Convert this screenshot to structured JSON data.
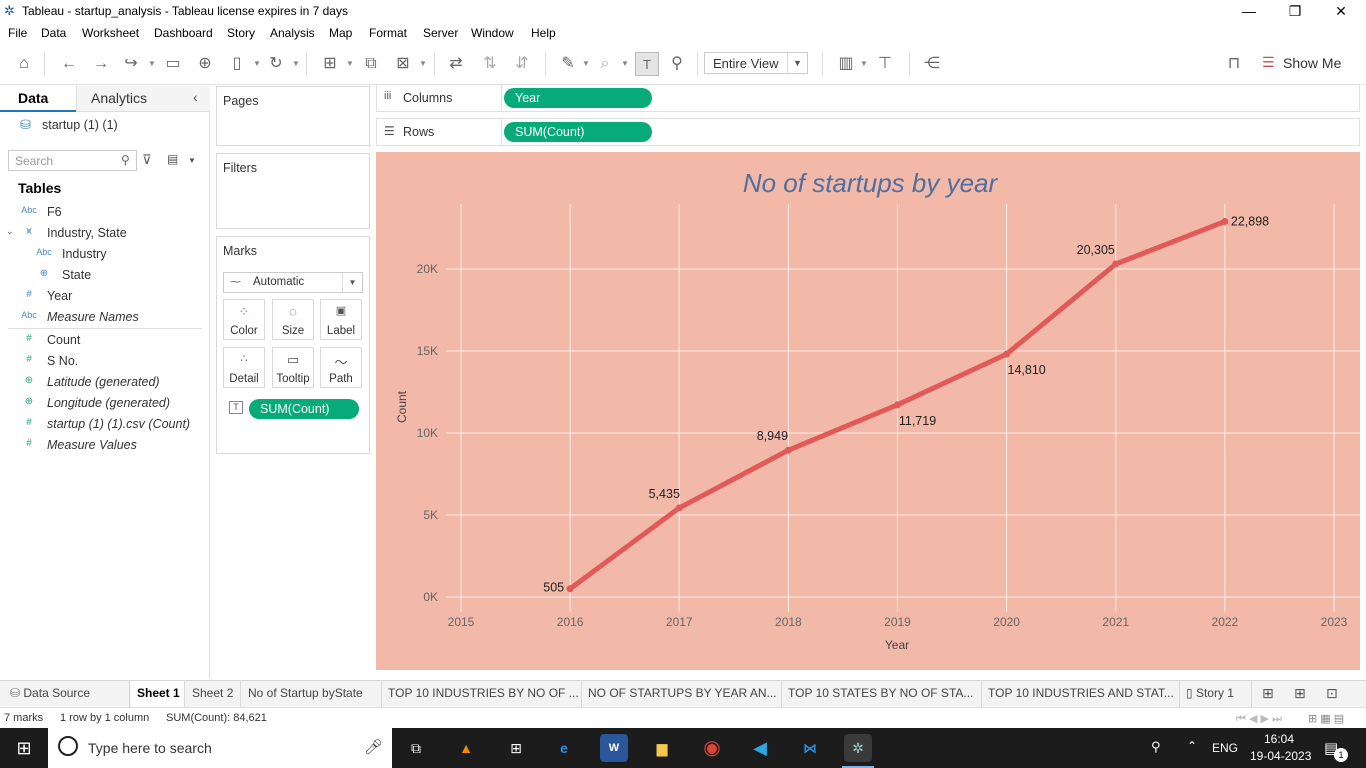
{
  "window": {
    "title": "Tableau - startup_analysis - Tableau license expires in 7 days"
  },
  "menu": [
    "File",
    "Data",
    "Worksheet",
    "Dashboard",
    "Story",
    "Analysis",
    "Map",
    "Format",
    "Server",
    "Window",
    "Help"
  ],
  "toolbar": {
    "fit_label": "Entire View",
    "show_me_label": "Show Me"
  },
  "data_pane": {
    "tabs": [
      "Data",
      "Analytics"
    ],
    "datasource": "startup (1) (1)",
    "search_placeholder": "Search",
    "tables_header": "Tables",
    "fields": [
      {
        "type": "Abc",
        "name": "F6"
      },
      {
        "type": "hier",
        "name": "Industry, State"
      },
      {
        "type": "Abc",
        "name": "Industry"
      },
      {
        "type": "geo",
        "name": "State"
      },
      {
        "type": "#",
        "name": "Year"
      },
      {
        "type": "Abc",
        "name": "Measure Names"
      },
      {
        "type": "#",
        "name": "Count"
      },
      {
        "type": "#",
        "name": "S No."
      },
      {
        "type": "geo",
        "name": "Latitude (generated)"
      },
      {
        "type": "geo",
        "name": "Longitude (generated)"
      },
      {
        "type": "#",
        "name": "startup (1) (1).csv (Count)"
      },
      {
        "type": "#",
        "name": "Measure Values"
      }
    ]
  },
  "cards": {
    "pages": "Pages",
    "filters": "Filters",
    "marks": "Marks",
    "mark_type": "Automatic",
    "mark_buttons": [
      "Color",
      "Size",
      "Label",
      "Detail",
      "Tooltip",
      "Path"
    ],
    "label_pill": "SUM(Count)"
  },
  "shelves": {
    "columns_label": "Columns",
    "columns_pill": "Year",
    "rows_label": "Rows",
    "rows_pill": "SUM(Count)"
  },
  "chart_data": {
    "type": "line",
    "title": "No of startups by year",
    "xlabel": "Year",
    "ylabel": "Count",
    "x_ticks": [
      "2015",
      "2016",
      "2017",
      "2018",
      "2019",
      "2020",
      "2021",
      "2022",
      "2023"
    ],
    "y_ticks": [
      "0K",
      "5K",
      "10K",
      "15K",
      "20K"
    ],
    "xlim": [
      2015,
      2023
    ],
    "ylim": [
      0,
      22898
    ],
    "x": [
      2016,
      2017,
      2018,
      2019,
      2020,
      2021,
      2022
    ],
    "y": [
      505,
      5435,
      8949,
      11719,
      14810,
      20305,
      22898
    ],
    "labels": [
      "505",
      "5,435",
      "8,949",
      "11,719",
      "14,810",
      "20,305",
      "22,898"
    ],
    "line_color": "#e05a5a",
    "background": "#f2b8a8",
    "title_color": "#4f6fa0",
    "grid": true
  },
  "sheet_tabs": [
    "Data Source",
    "Sheet 1",
    "Sheet 2",
    "No of Startup byState",
    "TOP 10 INDUSTRIES BY NO OF ...",
    "NO OF STARTUPS BY YEAR AN...",
    "TOP 10 STATES BY NO OF STA...",
    "TOP 10 INDUSTRIES AND STAT...",
    "Story 1"
  ],
  "status": {
    "marks": "7 marks",
    "layout": "1 row by 1 column",
    "sum": "SUM(Count): 84,621"
  },
  "taskbar": {
    "search_placeholder": "Type here to search",
    "lang": "ENG",
    "time": "16:04",
    "date": "19-04-2023",
    "notif_count": "1"
  }
}
